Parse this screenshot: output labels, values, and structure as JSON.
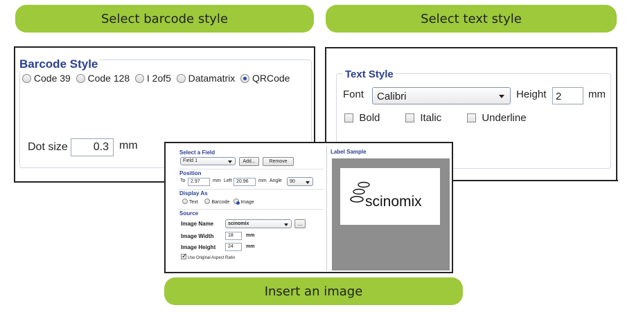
{
  "labels": {
    "barcode_style_pill": "Select barcode style",
    "text_style_pill": "Select text style",
    "insert_image_pill": "Insert an image"
  },
  "barcode": {
    "title": "Barcode Style",
    "options": [
      "Code 39",
      "Code 128",
      "I 2of5",
      "Datamatrix",
      "QRCode"
    ],
    "selected": "QRCode",
    "dot_size_label": "Dot size",
    "dot_size_value": "0.3",
    "dot_size_unit": "mm"
  },
  "text_style": {
    "title": "Text Style",
    "font_label": "Font",
    "font_value": "Calibri",
    "height_label": "Height",
    "height_value": "2",
    "height_unit": "mm",
    "bold": "Bold",
    "italic": "Italic",
    "underline": "Underline"
  },
  "image_dialog": {
    "select_field_title": "Select a Field",
    "field_value": "Field 1",
    "add_button": "Add...",
    "remove_button": "Remove",
    "position_title": "Position",
    "top_label": "To",
    "top_value": "2.97",
    "mm1": "mm",
    "left_label": "Left",
    "left_value": "20.96",
    "mm2": "mm",
    "angle_label": "Angle",
    "angle_value": "90",
    "display_as_title": "Display As",
    "display_options": [
      "Text",
      "Barcode",
      "Image"
    ],
    "display_selected": "Image",
    "source_title": "Source",
    "image_name_label": "Image Name",
    "image_name_value": "scinomix",
    "browse_button": "...",
    "image_width_label": "Image Width",
    "image_width_value": "18",
    "image_width_unit": "mm",
    "image_height_label": "Image Height",
    "image_height_value": "24",
    "image_height_unit": "mm",
    "aspect_label": "Use Original Aspect Ratio",
    "label_sample_title": "Label Sample",
    "logo_text": "scinomix"
  },
  "colors": {
    "pill": "#9dc93b",
    "legend": "#2b3f8f",
    "preview_gray": "#8e8e8e"
  }
}
